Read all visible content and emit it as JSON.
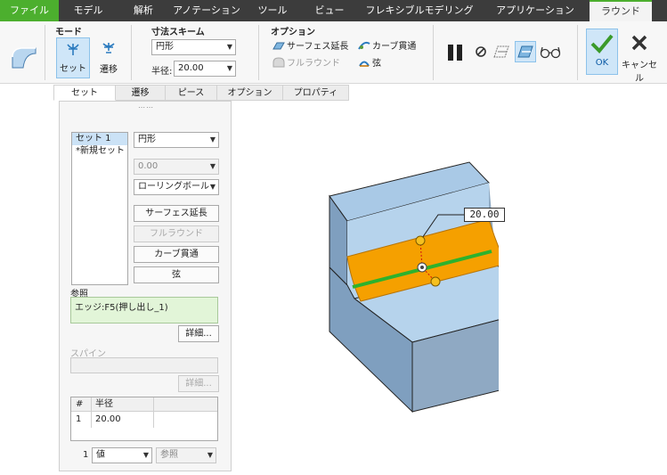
{
  "menu": {
    "tabs": [
      "ファイル",
      "モデル",
      "解析",
      "アノテーション",
      "ツール",
      "ビュー",
      "フレキシブルモデリング",
      "アプリケーション",
      "ラウンド"
    ]
  },
  "ribbon": {
    "mode": {
      "title": "モード",
      "set_label": "セット",
      "transition_label": "遷移"
    },
    "dim_scheme": {
      "title": "寸法スキーム",
      "shape_value": "円形",
      "radius_label": "半径:",
      "radius_value": "20.00"
    },
    "options": {
      "title": "オプション",
      "surface_extend": "サーフェス延長",
      "full_round": "フルラウンド",
      "curve_through": "カーブ貫通",
      "chord": "弦"
    },
    "ok_label": "OK",
    "cancel_label": "キャンセル"
  },
  "subtabs": [
    "セット",
    "遷移",
    "ピース",
    "オプション",
    "プロパティ"
  ],
  "panel": {
    "grip": "⋯⋯",
    "sets": [
      "セット 1",
      "*新規セット"
    ],
    "shape_select": "円形",
    "value_select": "0.00",
    "rolling_select": "ローリングボール",
    "btn_surface_extend": "サーフェス延長",
    "btn_full_round": "フルラウンド",
    "btn_curve_through": "カーブ貫通",
    "btn_chord": "弦",
    "references_label": "参照",
    "reference_value": "エッジ:F5(押し出し_1)",
    "details_btn": "詳細...",
    "spine_label": "スパイン",
    "spine_details_btn": "詳細...",
    "table": {
      "col_num": "#",
      "col_radius": "半径",
      "row_num": "1",
      "row_value": "20.00"
    },
    "footer_index": "1",
    "footer_value_select": "値",
    "footer_ref_select": "参照"
  },
  "viewport": {
    "dimension": "20.00"
  },
  "colors": {
    "file_tab": "#4caf2e",
    "round_surface": "#f5a000",
    "edge": "#2db22d",
    "solid": "#a9c9e6"
  }
}
